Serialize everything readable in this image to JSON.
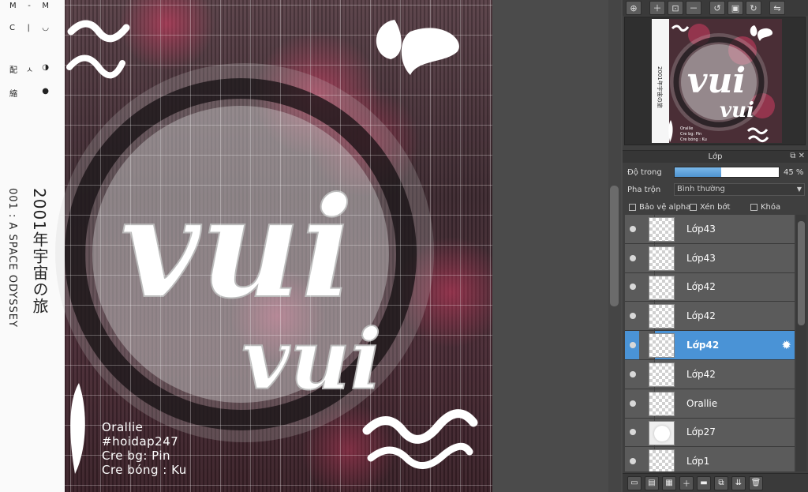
{
  "canvas": {
    "strip_title": "2001年宇宙の旅",
    "strip_subtitle": "001 : A SPACE ODYSSEY",
    "strip_marks": [
      [
        "M",
        "",
        "M"
      ],
      [
        "C",
        "",
        ""
      ],
      [
        "",
        "",
        ""
      ]
    ],
    "main_word": "vui",
    "second_word": "vui",
    "credits": [
      "Orallie",
      "#hoidap247",
      "Cre bg: Pin",
      "Cre bóng : Ku"
    ]
  },
  "navigator": {
    "toolbar_icons": [
      "zoom-fit-icon",
      "zoom-in-icon",
      "actual-size-icon",
      "zoom-out-icon",
      "rotate-left-icon",
      "fit-window-icon",
      "rotate-right-icon",
      "flip-icon"
    ],
    "thumb_word": "vui",
    "thumb_word2": "vui",
    "thumb_credits": [
      "Orallie",
      "Cre bg: Pin",
      "Cre bóng : Ku"
    ]
  },
  "layer_panel": {
    "title": "Lớp",
    "opacity_label": "Độ trong",
    "opacity_value": "45 %",
    "opacity_fraction": 0.45,
    "blend_label": "Pha trộn",
    "blend_value": "Bình thường",
    "protect_alpha": "Bảo vệ alpha",
    "clipping": "Xén bớt",
    "lock": "Khóa",
    "layers": [
      {
        "name": "Lớp43",
        "selected": false,
        "thumb": "transparent"
      },
      {
        "name": "Lớp43",
        "selected": false,
        "thumb": "transparent"
      },
      {
        "name": "Lớp42",
        "selected": false,
        "thumb": "transparent"
      },
      {
        "name": "Lớp42",
        "selected": false,
        "thumb": "transparent"
      },
      {
        "name": "Lớp42",
        "selected": true,
        "thumb": "transparent"
      },
      {
        "name": "Lớp42",
        "selected": false,
        "thumb": "transparent"
      },
      {
        "name": "Orallie",
        "selected": false,
        "thumb": "transparent"
      },
      {
        "name": "Lớp27",
        "selected": false,
        "thumb": "white-circle"
      },
      {
        "name": "Lớp1",
        "selected": false,
        "thumb": "transparent"
      }
    ]
  },
  "colors": {
    "selected_layer": "#4a93d6",
    "panel_bg": "#3f3f3f",
    "opacity_fill": "#5aa0dc"
  }
}
